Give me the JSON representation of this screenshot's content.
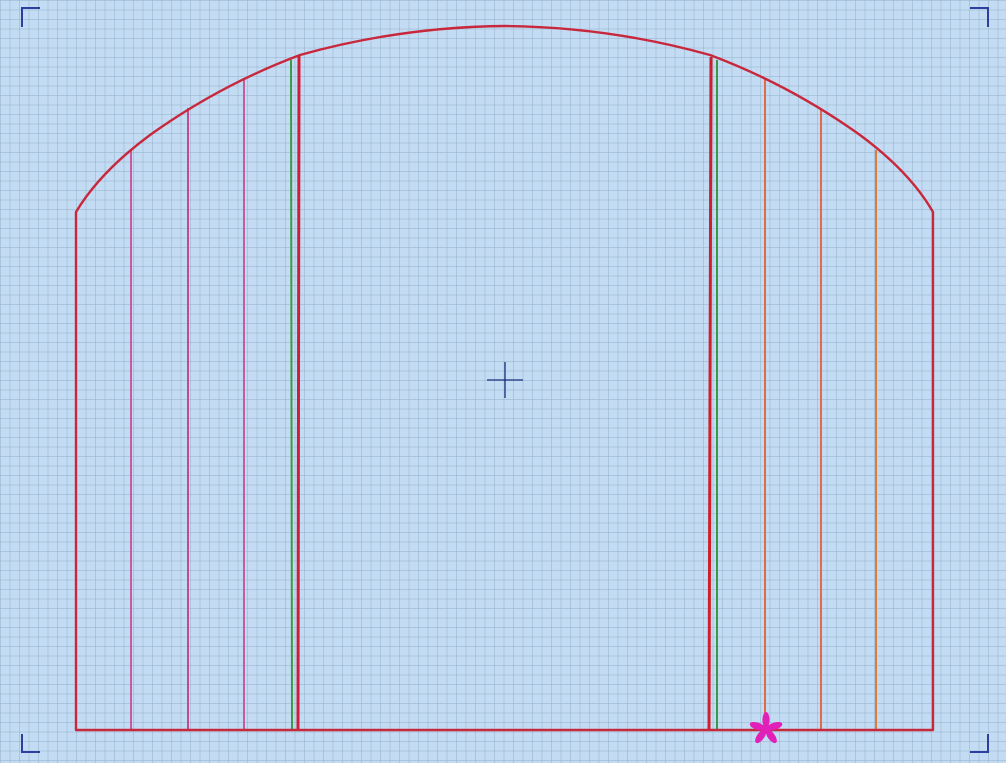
{
  "app": {
    "view": "embroidery-design-canvas"
  },
  "canvas": {
    "background_color": "#c4dcf3",
    "grid_color": "#97b4cd",
    "hoop_corner_color": "#2a3f9e",
    "center_mark_color": "#1a2f7a"
  },
  "design": {
    "outline_color": "#c8283c",
    "stitch_lines": [
      {
        "name": "stitch-line-1",
        "color": "#c75aa0"
      },
      {
        "name": "stitch-line-2",
        "color": "#c64a92"
      },
      {
        "name": "stitch-line-3",
        "color": "#c75aa0"
      },
      {
        "name": "stitch-line-4",
        "color": "#3a9a45"
      },
      {
        "name": "stitch-line-5",
        "color": "#d01e3a"
      },
      {
        "name": "stitch-line-6",
        "color": "#d01e2a"
      },
      {
        "name": "stitch-line-7",
        "color": "#3a9a45"
      },
      {
        "name": "stitch-line-8",
        "color": "#e06a4a"
      },
      {
        "name": "stitch-line-9",
        "color": "#e06a4a"
      },
      {
        "name": "stitch-line-10",
        "color": "#e07a3a"
      }
    ],
    "start_marker": {
      "icon": "asterisk-start-point-icon",
      "color": "#e020b8"
    }
  }
}
